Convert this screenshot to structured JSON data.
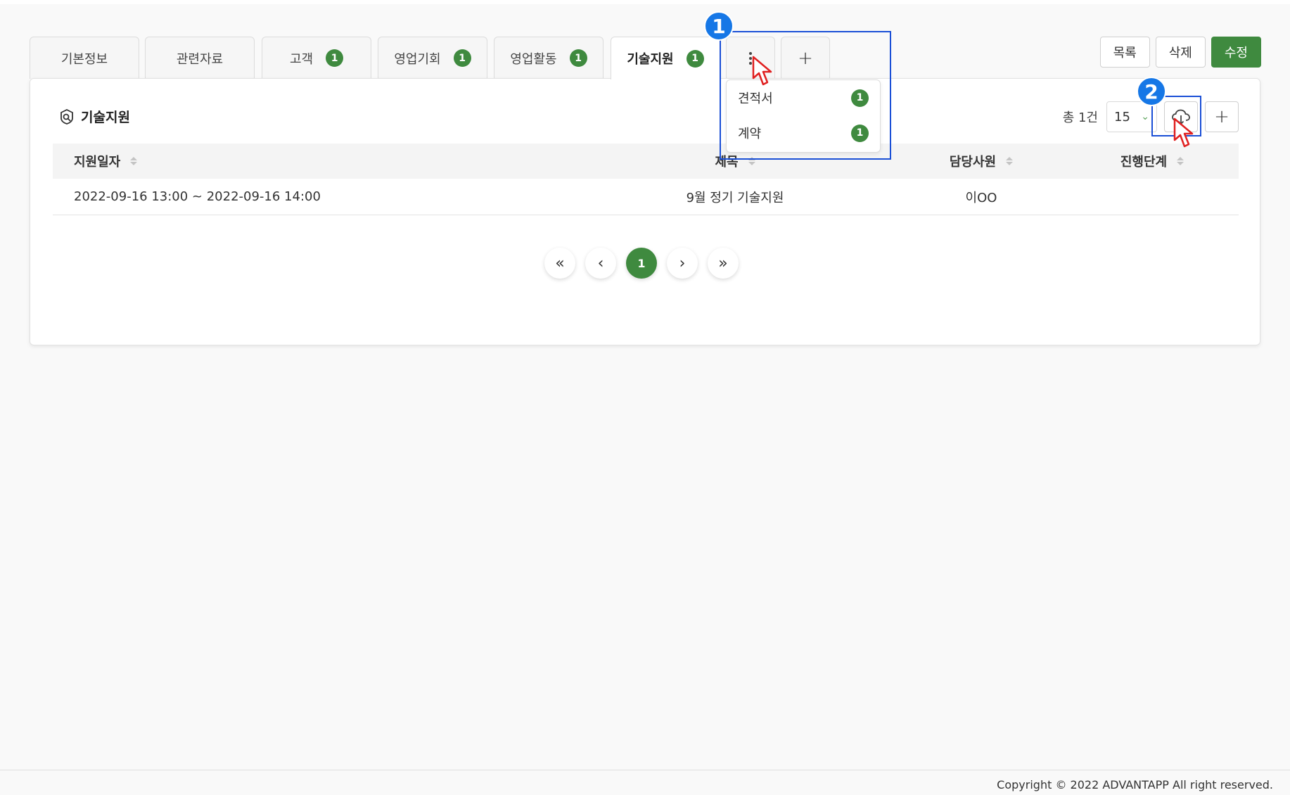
{
  "tabs": [
    {
      "label": "기본정보",
      "badge": null
    },
    {
      "label": "관련자료",
      "badge": null
    },
    {
      "label": "고객",
      "badge": "1"
    },
    {
      "label": "영업기회",
      "badge": "1"
    },
    {
      "label": "영업활동",
      "badge": "1"
    },
    {
      "label": "기술지원",
      "badge": "1",
      "active": true
    }
  ],
  "tab_add_label": "+",
  "more_menu": [
    {
      "label": "견적서",
      "badge": "1"
    },
    {
      "label": "계약",
      "badge": "1"
    }
  ],
  "actions": {
    "list": "목록",
    "delete": "삭제",
    "edit": "수정"
  },
  "section": {
    "title": "기술지원"
  },
  "toolbar": {
    "total": "총 1건",
    "page_size": "15",
    "add_label": "+"
  },
  "table": {
    "headers": [
      "지원일자",
      "제목",
      "담당사원",
      "진행단계"
    ],
    "rows": [
      [
        "2022-09-16 13:00 ~ 2022-09-16 14:00",
        "9월 정기 기술지원",
        "이OO",
        ""
      ]
    ]
  },
  "pagination": {
    "first": "«",
    "prev": "‹",
    "current": "1",
    "next": "›",
    "last": "»"
  },
  "markers": [
    "1",
    "2"
  ],
  "footer": "Copyright © 2022 ADVANTAPP All right reserved.",
  "colors": {
    "accent": "#3f8a3f",
    "highlight": "#1a4fd6",
    "marker": "#1677e6"
  }
}
